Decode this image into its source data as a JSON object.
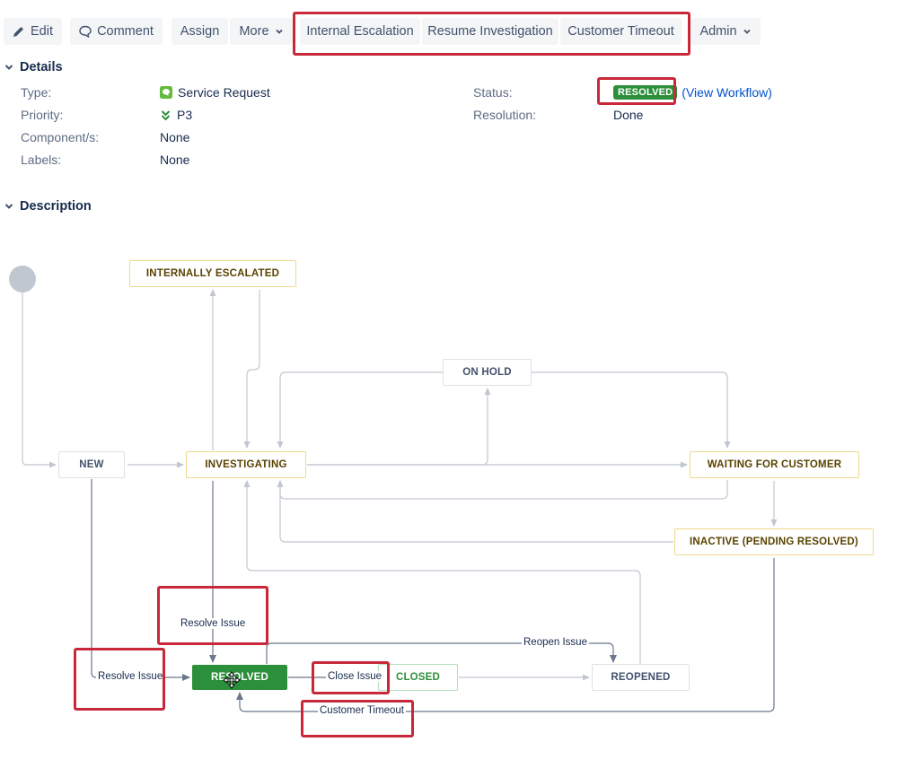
{
  "toolbar": {
    "edit": "Edit",
    "comment": "Comment",
    "assign": "Assign",
    "more": "More",
    "transitions": [
      "Internal Escalation",
      "Resume Investigation",
      "Customer Timeout"
    ],
    "admin": "Admin"
  },
  "details": {
    "heading": "Details",
    "type_label": "Type:",
    "type_value": "Service Request",
    "priority_label": "Priority:",
    "priority_value": "P3",
    "components_label": "Component/s:",
    "components_value": "None",
    "labels_label": "Labels:",
    "labels_value": "None",
    "status_label": "Status:",
    "status_value": "RESOLVED",
    "view_workflow": "(View Workflow)",
    "resolution_label": "Resolution:",
    "resolution_value": "Done"
  },
  "description": {
    "heading": "Description"
  },
  "workflow": {
    "states": {
      "internally_escalated": "INTERNALLY ESCALATED",
      "on_hold": "ON HOLD",
      "new": "NEW",
      "investigating": "INVESTIGATING",
      "waiting_for_customer": "WAITING FOR CUSTOMER",
      "inactive": "INACTIVE (PENDING RESOLVED)",
      "resolved": "RESOLVED",
      "closed": "CLOSED",
      "reopened": "REOPENED"
    },
    "transitions": {
      "resolve_issue_top": "Resolve Issue",
      "resolve_issue_left": "Resolve Issue",
      "reopen_issue": "Reopen Issue",
      "close_issue": "Close Issue",
      "customer_timeout": "Customer Timeout"
    }
  },
  "colors": {
    "highlight": "#c8283a",
    "resolved_green": "#2c8f3b",
    "link_blue": "#0052cc",
    "button_bg": "#f4f5f7"
  }
}
